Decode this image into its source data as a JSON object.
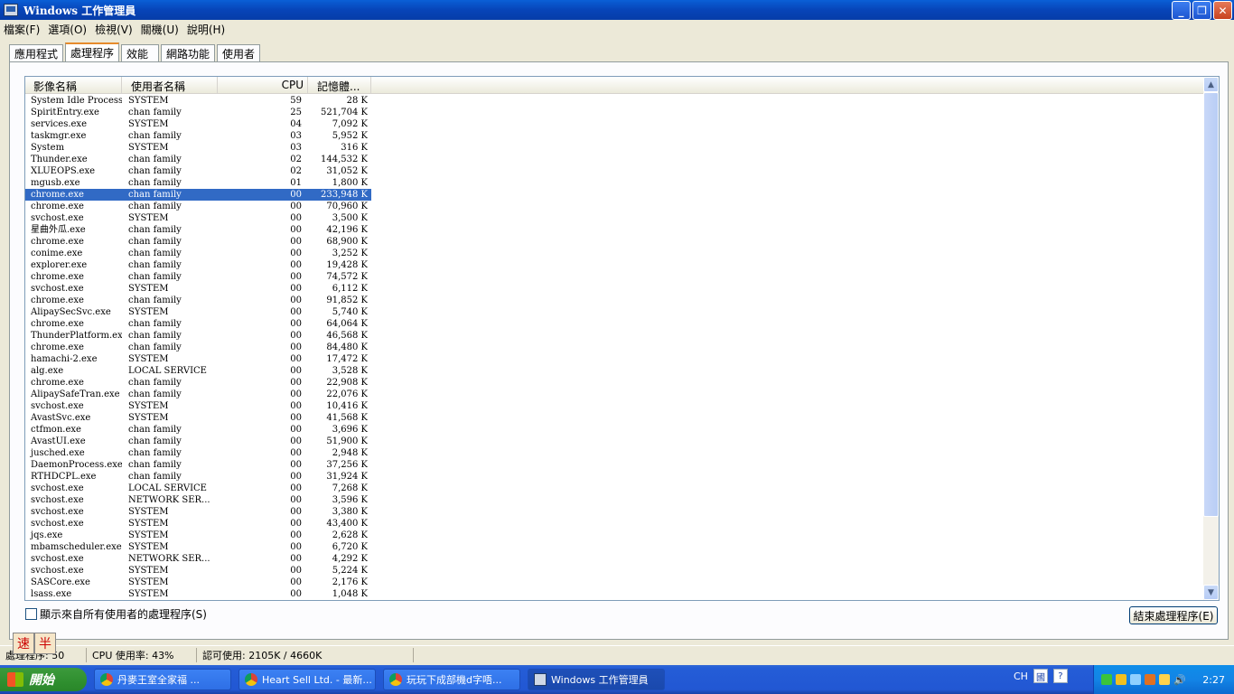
{
  "window": {
    "title": "Windows 工作管理員"
  },
  "menu": [
    "檔案(F)",
    "選項(O)",
    "檢視(V)",
    "關機(U)",
    "說明(H)"
  ],
  "tabs": [
    "應用程式",
    "處理程序",
    "效能",
    "網路功能",
    "使用者"
  ],
  "columns": [
    "影像名稱",
    "使用者名稱",
    "CPU",
    "記憶體..."
  ],
  "processes": [
    [
      "System Idle Process",
      "SYSTEM",
      "59",
      "28 K"
    ],
    [
      "SpiritEntry.exe",
      "chan family",
      "25",
      "521,704 K"
    ],
    [
      "services.exe",
      "SYSTEM",
      "04",
      "7,092 K"
    ],
    [
      "taskmgr.exe",
      "chan family",
      "03",
      "5,952 K"
    ],
    [
      "System",
      "SYSTEM",
      "03",
      "316 K"
    ],
    [
      "Thunder.exe",
      "chan family",
      "02",
      "144,532 K"
    ],
    [
      "XLUEOPS.exe",
      "chan family",
      "02",
      "31,052 K"
    ],
    [
      "mgusb.exe",
      "chan family",
      "01",
      "1,800 K"
    ],
    [
      "chrome.exe",
      "chan family",
      "00",
      "233,948 K"
    ],
    [
      "chrome.exe",
      "chan family",
      "00",
      "70,960 K"
    ],
    [
      "svchost.exe",
      "SYSTEM",
      "00",
      "3,500 K"
    ],
    [
      "星曲外瓜.exe",
      "chan family",
      "00",
      "42,196 K"
    ],
    [
      "chrome.exe",
      "chan family",
      "00",
      "68,900 K"
    ],
    [
      "conime.exe",
      "chan family",
      "00",
      "3,252 K"
    ],
    [
      "explorer.exe",
      "chan family",
      "00",
      "19,428 K"
    ],
    [
      "chrome.exe",
      "chan family",
      "00",
      "74,572 K"
    ],
    [
      "svchost.exe",
      "SYSTEM",
      "00",
      "6,112 K"
    ],
    [
      "chrome.exe",
      "chan family",
      "00",
      "91,852 K"
    ],
    [
      "AlipaySecSvc.exe",
      "SYSTEM",
      "00",
      "5,740 K"
    ],
    [
      "chrome.exe",
      "chan family",
      "00",
      "64,064 K"
    ],
    [
      "ThunderPlatform.exe",
      "chan family",
      "00",
      "46,568 K"
    ],
    [
      "chrome.exe",
      "chan family",
      "00",
      "84,480 K"
    ],
    [
      "hamachi-2.exe",
      "SYSTEM",
      "00",
      "17,472 K"
    ],
    [
      "alg.exe",
      "LOCAL SERVICE",
      "00",
      "3,528 K"
    ],
    [
      "chrome.exe",
      "chan family",
      "00",
      "22,908 K"
    ],
    [
      "AlipaySafeTran.exe",
      "chan family",
      "00",
      "22,076 K"
    ],
    [
      "svchost.exe",
      "SYSTEM",
      "00",
      "10,416 K"
    ],
    [
      "AvastSvc.exe",
      "SYSTEM",
      "00",
      "41,568 K"
    ],
    [
      "ctfmon.exe",
      "chan family",
      "00",
      "3,696 K"
    ],
    [
      "AvastUI.exe",
      "chan family",
      "00",
      "51,900 K"
    ],
    [
      "jusched.exe",
      "chan family",
      "00",
      "2,948 K"
    ],
    [
      "DaemonProcess.exe",
      "chan family",
      "00",
      "37,256 K"
    ],
    [
      "RTHDCPL.exe",
      "chan family",
      "00",
      "31,924 K"
    ],
    [
      "svchost.exe",
      "LOCAL SERVICE",
      "00",
      "7,268 K"
    ],
    [
      "svchost.exe",
      "NETWORK SER...",
      "00",
      "3,596 K"
    ],
    [
      "svchost.exe",
      "SYSTEM",
      "00",
      "3,380 K"
    ],
    [
      "svchost.exe",
      "SYSTEM",
      "00",
      "43,400 K"
    ],
    [
      "jqs.exe",
      "SYSTEM",
      "00",
      "2,628 K"
    ],
    [
      "mbamscheduler.exe",
      "SYSTEM",
      "00",
      "6,720 K"
    ],
    [
      "svchost.exe",
      "NETWORK SER...",
      "00",
      "4,292 K"
    ],
    [
      "svchost.exe",
      "SYSTEM",
      "00",
      "5,224 K"
    ],
    [
      "SASCore.exe",
      "SYSTEM",
      "00",
      "2,176 K"
    ],
    [
      "lsass.exe",
      "SYSTEM",
      "00",
      "1,048 K"
    ]
  ],
  "selected_row": 8,
  "show_all_label": "顯示來自所有使用者的處理程序(S)",
  "end_process_label": "結束處理程序(E)",
  "status": {
    "processes": "處理程序: 50",
    "cpu": "CPU 使用率: 43%",
    "commit": "認可使用: 2105K / 4660K"
  },
  "ime": [
    "速",
    "半"
  ],
  "taskbar": {
    "start": "開始",
    "buttons": [
      "丹麥王室全家福 ...",
      "Heart Sell Ltd. - 最新...",
      "玩玩下成部機d字唔...",
      "Windows 工作管理員"
    ],
    "lang": "CH",
    "clock": "2:27"
  }
}
